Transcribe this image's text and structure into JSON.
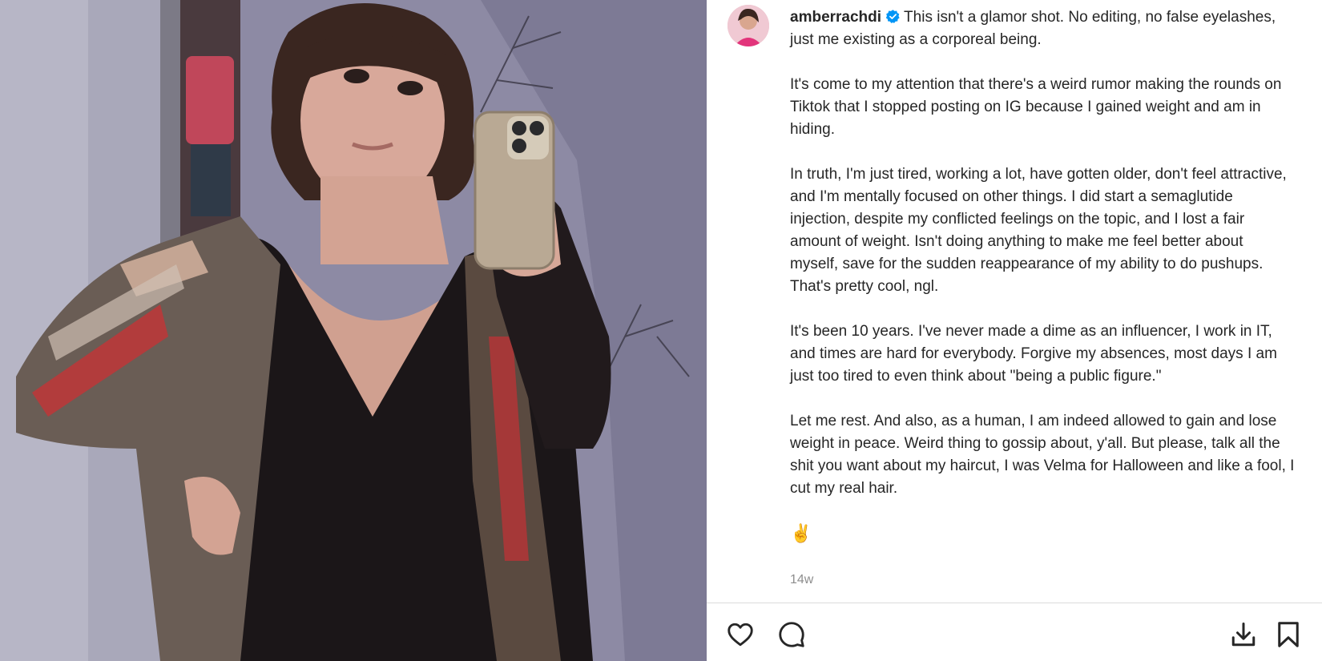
{
  "post": {
    "username": "amberrachdi",
    "verified": true,
    "caption_first": "This isn't a glamor shot. No editing, no false eyelashes, just me existing as a corporeal being.",
    "paragraphs": [
      "It's come to my attention that there's a weird rumor making the rounds on Tiktok that I stopped posting on IG because I gained weight and am in hiding.",
      "In truth, I'm just tired, working a lot, have gotten older, don't feel attractive, and I'm mentally focused on other things. I did start a semaglutide injection, despite my conflicted feelings on the topic, and I lost a fair amount of weight. Isn't doing anything to make me feel better about myself, save for the sudden reappearance of my ability to do pushups. That's pretty cool, ngl.",
      "It's been 10 years. I've never made a dime as an influencer, I work in IT, and times are hard for everybody. Forgive my absences, most days I am just too tired to even think about \"being a public figure.\"",
      "Let me rest. And also, as a human, I am indeed allowed to gain and lose weight in peace. Weird thing to gossip about, y'all. But please, talk all the shit you want about my haircut, I was Velma for Halloween and like a fool, I cut my real hair."
    ],
    "emoji": "✌️",
    "timestamp": "14w"
  },
  "icons": {
    "verified": "verified-badge-icon",
    "like": "heart-icon",
    "comment": "comment-bubble-icon",
    "download": "download-icon",
    "save": "bookmark-icon"
  },
  "colors": {
    "text": "#262626",
    "muted": "#8e8e8e",
    "verified": "#0095f6",
    "divider": "#dbdbdb"
  }
}
